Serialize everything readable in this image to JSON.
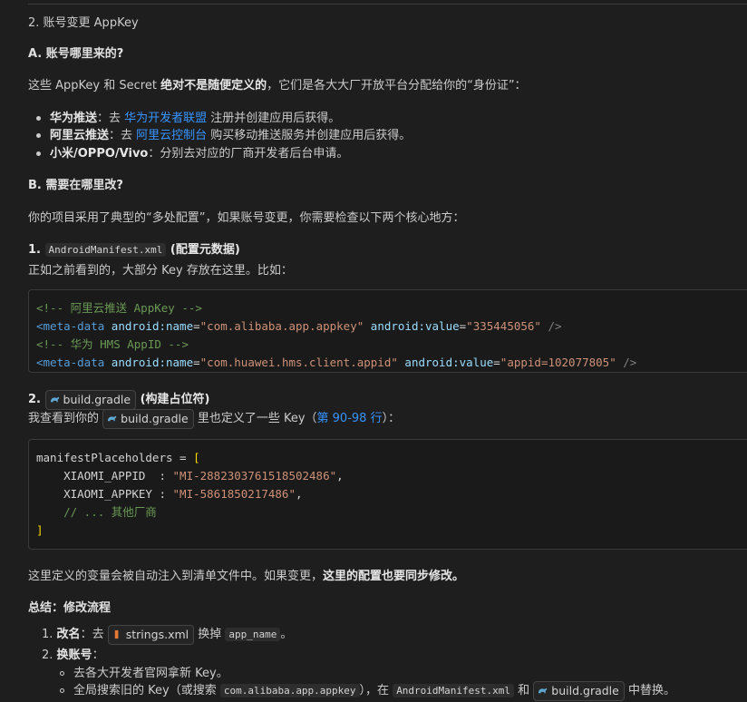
{
  "section_title": "2. 账号变更 AppKey",
  "part_a": {
    "heading": "A. 账号哪里来的?",
    "intro_pre": "这些 AppKey 和 Secret ",
    "intro_bold": "绝对不是随便定义的",
    "intro_post": "，它们是各大大厂开放平台分配给你的“身份证”：",
    "items": [
      {
        "label": "华为推送",
        "pre": "：去 ",
        "link": "华为开发者联盟",
        "post": " 注册并创建应用后获得。"
      },
      {
        "label": "阿里云推送",
        "pre": "：去 ",
        "link": "阿里云控制台",
        "post": " 购买移动推送服务并创建应用后获得。"
      },
      {
        "label": "小米/OPPO/Vivo",
        "pre": "：分别去对应的厂商开发者后台申请。",
        "link": "",
        "post": ""
      }
    ]
  },
  "part_b": {
    "heading": "B. 需要在哪里改?",
    "intro": "你的项目采用了典型的“多处配置”，如果账号变更，你需要检查以下两个核心地方：",
    "step1_num": "1. ",
    "step1_code": "AndroidManifest.xml",
    "step1_suffix": " (配置元数据)",
    "step1_desc": "正如之前看到的，大部分 Key 存放在这里。比如：",
    "xml": {
      "comment1": "<!-- 阿里云推送 AppKey -->",
      "line1_tag": "<meta-data",
      "line1_attr1": "android:name",
      "line1_val1": "\"com.alibaba.app.appkey\"",
      "line1_attr2": "android:value",
      "line1_val2": "\"335445056\"",
      "close": "/>",
      "comment2": "<!-- 华为 HMS AppID -->",
      "line2_tag": "<meta-data",
      "line2_attr1": "android:name",
      "line2_val1": "\"com.huawei.hms.client.appid\"",
      "line2_attr2": "android:value",
      "line2_val2": "\"appid=102077805\""
    },
    "step2_num": "2. ",
    "step2_chip": "build.gradle",
    "step2_suffix": " (构建占位符)",
    "step2_desc_pre": "我查看到你的 ",
    "step2_desc_chip": "build.gradle",
    "step2_desc_mid": " 里也定义了一些 Key（",
    "step2_desc_link": "第 90-98 行",
    "step2_desc_post": "）：",
    "gradle": {
      "line1": "manifestPlaceholders = ",
      "bracket_open": "[",
      "key1": "    XIAOMI_APPID  : ",
      "val1": "\"MI-2882303761518502486\"",
      "key2": "    XIAOMI_APPKEY : ",
      "val2": "\"MI-5861850217486\"",
      "comma": ",",
      "comment": "    // ... 其他厂商",
      "bracket_close": "]"
    },
    "note_pre": "这里定义的变量会被自动注入到清单文件中。如果变更，",
    "note_bold": "这里的配置也要同步修改。"
  },
  "summary": {
    "heading": "总结：修改流程",
    "item1_num": "1. ",
    "item1_label": "改名",
    "item1_pre": "：去 ",
    "item1_chip": "strings.xml",
    "item1_mid": " 换掉 ",
    "item1_code": "app_name",
    "item1_post": "。",
    "item2_num": "2. ",
    "item2_label": "换账号",
    "item2_colon": "：",
    "sub1": "去各大开发者官网拿新 Key。",
    "sub2_pre": "全局搜索旧的 Key（或搜索 ",
    "sub2_code1": "com.alibaba.app.appkey",
    "sub2_mid": "），在 ",
    "sub2_code2": "AndroidManifest.xml",
    "sub2_and": " 和 ",
    "sub2_chip": "build.gradle",
    "sub2_post": " 中替换。"
  },
  "icons": {
    "gradle": "gradle-elephant-icon",
    "xml": "xml-file-icon"
  },
  "colors": {
    "background": "#1e1e1e",
    "link": "#3794ff",
    "comment": "#6a9955",
    "string": "#ce9178",
    "tag": "#569cd6",
    "attr": "#9cdcfe"
  }
}
